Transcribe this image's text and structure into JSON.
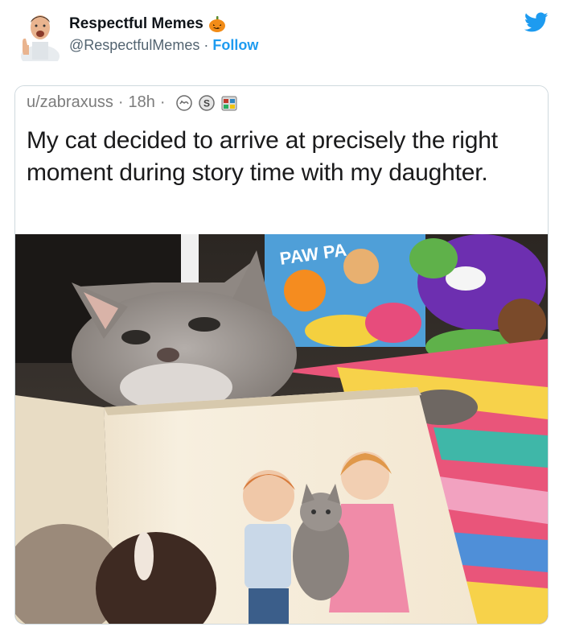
{
  "tweet": {
    "display_name": "Respectful Memes",
    "name_emoji_icon": "pumpkin-icon",
    "handle": "@RespectfulMemes",
    "separator": "·",
    "follow_label": "Follow",
    "platform_icon": "twitter-bird-icon"
  },
  "reddit_post": {
    "username": "u/zabraxuss",
    "separator": "·",
    "age": "18h",
    "awards": [
      "wholesome-award-icon",
      "silver-award-icon",
      "calendar-award-icon"
    ],
    "title": "My cat decided to arrive at precisely the right moment during story time with my daughter."
  },
  "photo": {
    "subject": "photo-cat-over-picture-book",
    "toy_box_text": "PAW PA"
  },
  "colors": {
    "twitter_blue": "#1d9bf0",
    "handle_gray": "#536471",
    "card_border": "#cfd9de",
    "reddit_meta_gray": "#7c7c7c"
  }
}
